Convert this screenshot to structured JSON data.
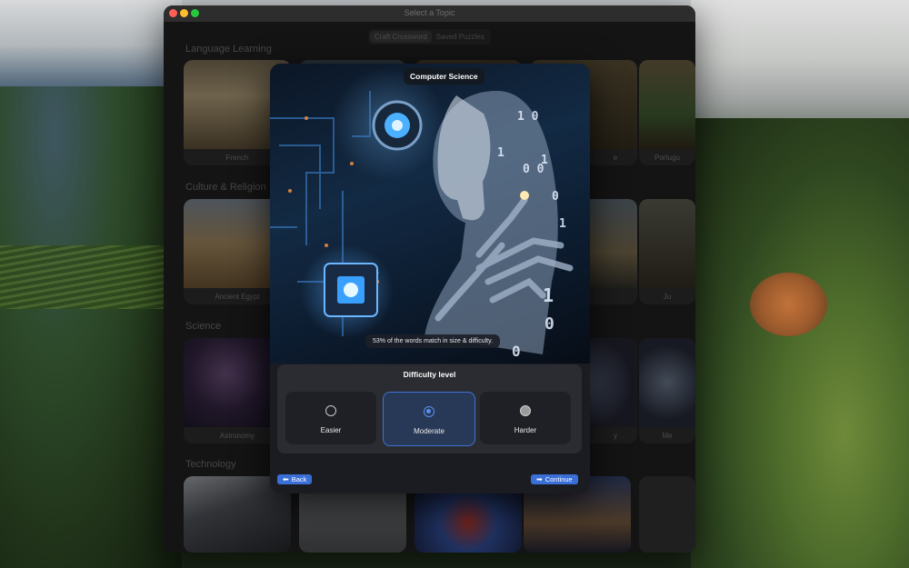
{
  "window": {
    "title": "Select a Topic"
  },
  "segmented": {
    "items": [
      "Craft Crossword",
      "Saved Puzzles"
    ],
    "selected": "Craft Crossword"
  },
  "sections": [
    {
      "title": "Language Learning",
      "cards": [
        "French",
        "",
        "",
        "e",
        "Portugu"
      ]
    },
    {
      "title": "Culture & Religion",
      "cards": [
        "Ancient Egypt",
        "",
        "",
        "",
        "Ju"
      ]
    },
    {
      "title": "Science",
      "cards": [
        "Astronomy",
        "",
        "",
        "y",
        "Me"
      ]
    },
    {
      "title": "Technology",
      "cards": [
        "",
        "",
        "",
        "",
        ""
      ]
    }
  ],
  "modal": {
    "title": "Computer Science",
    "match_text": "53% of the words match in size & difficulty.",
    "difficulty": {
      "title": "Difficulty level",
      "options": [
        "Easier",
        "Moderate",
        "Harder"
      ],
      "selected": "Moderate"
    },
    "back_label": "Back",
    "continue_label": "Continue"
  },
  "colors": {
    "accent": "#3a6fd8",
    "selected_bg": "#283957",
    "panel_bg": "#2b2c32"
  }
}
